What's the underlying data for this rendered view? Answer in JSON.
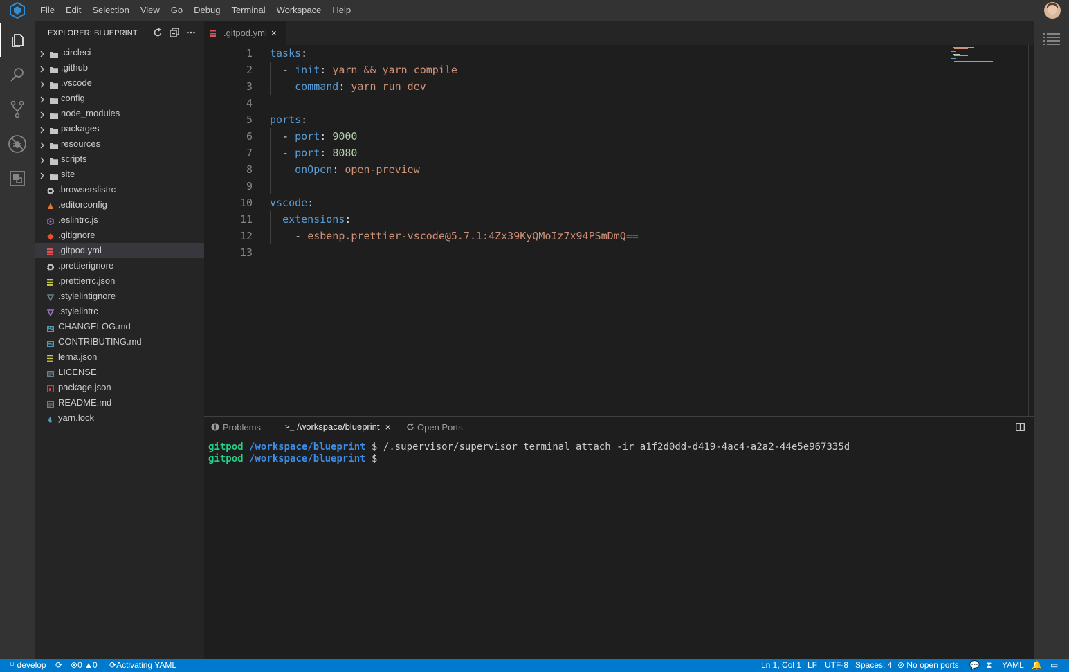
{
  "menu": [
    "File",
    "Edit",
    "Selection",
    "View",
    "Go",
    "Debug",
    "Terminal",
    "Workspace",
    "Help"
  ],
  "sidebar": {
    "title": "EXPLORER: BLUEPRINT",
    "folders": [
      ".circleci",
      ".github",
      ".vscode",
      "config",
      "node_modules",
      "packages",
      "resources",
      "scripts",
      "site"
    ],
    "files": [
      {
        "name": ".browserslistrc",
        "icon": "gear-icon",
        "color": "#cccccc"
      },
      {
        "name": ".editorconfig",
        "icon": "editorconfig-icon",
        "color": "#e37933"
      },
      {
        "name": ".eslintrc.js",
        "icon": "eslint-icon",
        "color": "#a074c4"
      },
      {
        "name": ".gitignore",
        "icon": "git-icon",
        "color": "#f14c28"
      },
      {
        "name": ".gitpod.yml",
        "icon": "yaml-icon",
        "color": "#e05252"
      },
      {
        "name": ".prettierignore",
        "icon": "gear-icon",
        "color": "#cccccc"
      },
      {
        "name": ".prettierrc.json",
        "icon": "json-icon",
        "color": "#cbcb41"
      },
      {
        "name": ".stylelintignore",
        "icon": "stylelint-icon",
        "color": "#6d8086"
      },
      {
        "name": ".stylelintrc",
        "icon": "stylelint-icon",
        "color": "#a074c4"
      },
      {
        "name": "CHANGELOG.md",
        "icon": "markdown-icon",
        "color": "#519aba"
      },
      {
        "name": "CONTRIBUTING.md",
        "icon": "markdown-icon",
        "color": "#519aba"
      },
      {
        "name": "lerna.json",
        "icon": "json-icon",
        "color": "#cbcb41"
      },
      {
        "name": "LICENSE",
        "icon": "license-icon",
        "color": "#6d8086"
      },
      {
        "name": "package.json",
        "icon": "npm-icon",
        "color": "#cc3e44"
      },
      {
        "name": "README.md",
        "icon": "readme-icon",
        "color": "#6d8086"
      },
      {
        "name": "yarn.lock",
        "icon": "yarn-icon",
        "color": "#519aba"
      }
    ],
    "selected": ".gitpod.yml"
  },
  "editor": {
    "tab_label": ".gitpod.yml",
    "tab_close": "×",
    "lines": [
      {
        "num": "1",
        "tokens": [
          {
            "t": "tasks",
            "c": "k"
          },
          {
            "t": ":",
            "c": "p"
          }
        ]
      },
      {
        "num": "2",
        "tokens": [
          {
            "t": "  - ",
            "c": "p"
          },
          {
            "t": "init",
            "c": "k"
          },
          {
            "t": ": ",
            "c": "p"
          },
          {
            "t": "yarn && yarn compile",
            "c": "v"
          }
        ]
      },
      {
        "num": "3",
        "tokens": [
          {
            "t": "    ",
            "c": "p"
          },
          {
            "t": "command",
            "c": "k"
          },
          {
            "t": ": ",
            "c": "p"
          },
          {
            "t": "yarn run dev",
            "c": "v"
          }
        ]
      },
      {
        "num": "4",
        "tokens": []
      },
      {
        "num": "5",
        "tokens": [
          {
            "t": "ports",
            "c": "k"
          },
          {
            "t": ":",
            "c": "p"
          }
        ]
      },
      {
        "num": "6",
        "tokens": [
          {
            "t": "  - ",
            "c": "p"
          },
          {
            "t": "port",
            "c": "k"
          },
          {
            "t": ": ",
            "c": "p"
          },
          {
            "t": "9000",
            "c": "n"
          }
        ]
      },
      {
        "num": "7",
        "tokens": [
          {
            "t": "  - ",
            "c": "p"
          },
          {
            "t": "port",
            "c": "k"
          },
          {
            "t": ": ",
            "c": "p"
          },
          {
            "t": "8080",
            "c": "n"
          }
        ]
      },
      {
        "num": "8",
        "tokens": [
          {
            "t": "    ",
            "c": "p"
          },
          {
            "t": "onOpen",
            "c": "k"
          },
          {
            "t": ": ",
            "c": "p"
          },
          {
            "t": "open-preview",
            "c": "v"
          }
        ]
      },
      {
        "num": "9",
        "tokens": []
      },
      {
        "num": "10",
        "tokens": [
          {
            "t": "vscode",
            "c": "k"
          },
          {
            "t": ":",
            "c": "p"
          }
        ]
      },
      {
        "num": "11",
        "tokens": [
          {
            "t": "  ",
            "c": "p"
          },
          {
            "t": "extensions",
            "c": "k"
          },
          {
            "t": ":",
            "c": "p"
          }
        ]
      },
      {
        "num": "12",
        "tokens": [
          {
            "t": "    - ",
            "c": "p"
          },
          {
            "t": "esbenp.prettier-vscode@5.7.1:4Zx39KyQMoIz7x94PSmDmQ==",
            "c": "v"
          }
        ]
      },
      {
        "num": "13",
        "tokens": []
      }
    ]
  },
  "panel": {
    "tabs": [
      "Problems",
      "/workspace/blueprint",
      "Open Ports"
    ],
    "close": "×",
    "terminal": [
      {
        "user": "gitpod",
        "path": "/workspace/blueprint",
        "prompt": "$",
        "cmd": " /.supervisor/supervisor terminal attach -ir a1f2d0dd-d419-4ac4-a2a2-44e5e967335d"
      },
      {
        "user": "gitpod",
        "path": "/workspace/blueprint",
        "prompt": "$",
        "cmd": ""
      }
    ]
  },
  "status": {
    "branch": "develop",
    "errors": "0",
    "warnings": "0",
    "activity": "Activating YAML",
    "position": "Ln 1, Col 1",
    "eol": "LF",
    "encoding": "UTF-8",
    "spaces": "Spaces: 4",
    "ports": "No open ports",
    "language": "YAML"
  }
}
